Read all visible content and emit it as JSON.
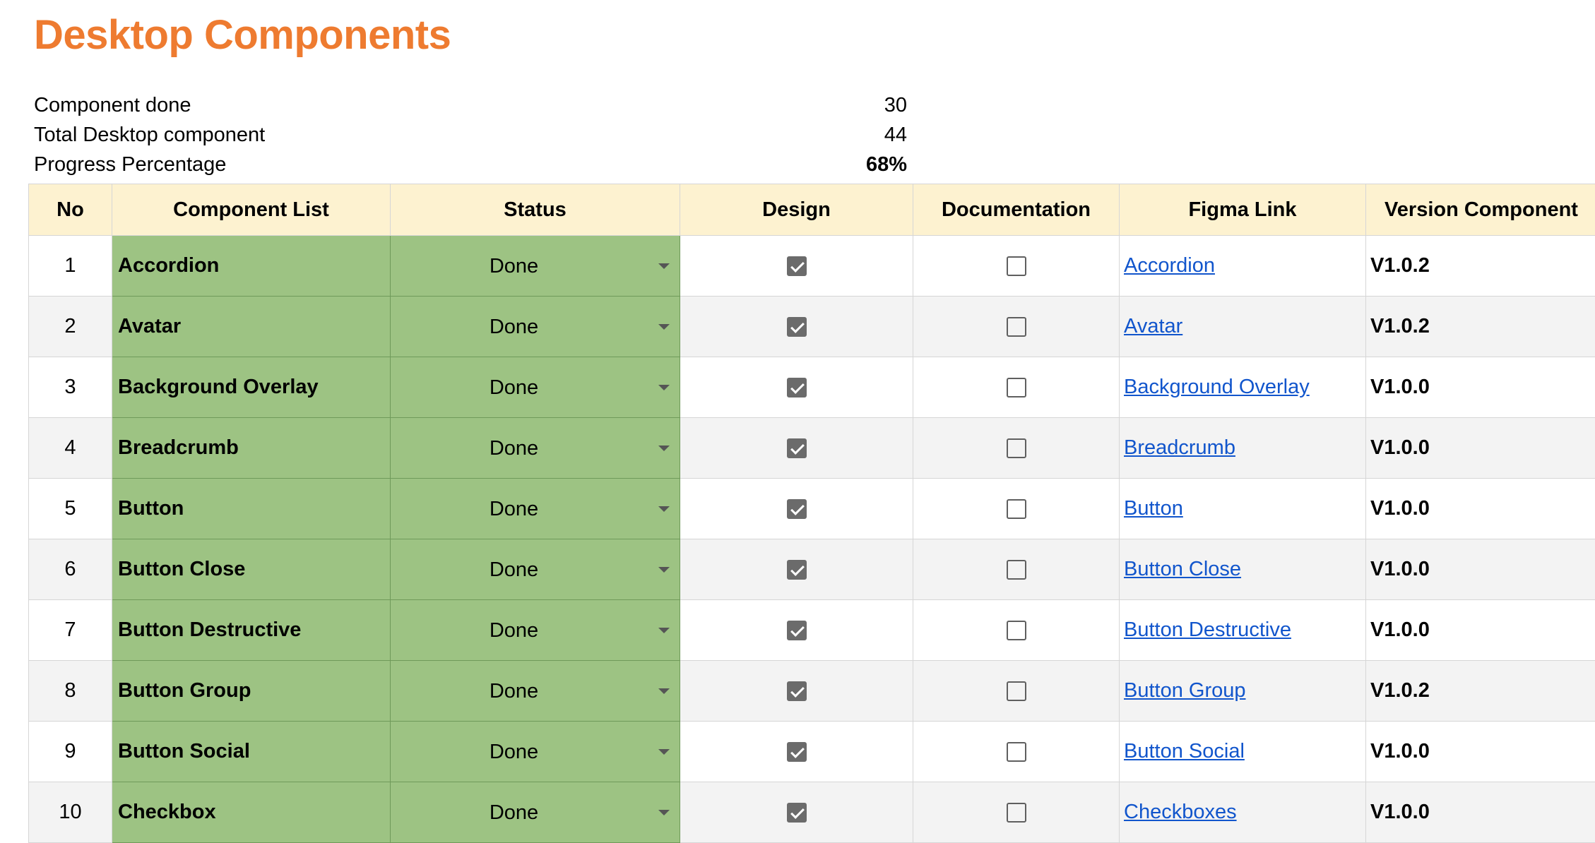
{
  "title": "Desktop Components",
  "summary": [
    {
      "label": "Component done",
      "value": "30"
    },
    {
      "label": "Total Desktop component",
      "value": "44"
    },
    {
      "label": "Progress Percentage",
      "value": "68%"
    }
  ],
  "colors": {
    "title": "#ee7b30",
    "header_bg": "#fdf2d0",
    "done_green": "#9dc383",
    "link": "#1155cc"
  },
  "table": {
    "headers": [
      "No",
      "Component List",
      "Status",
      "Design",
      "Documentation",
      "Figma Link",
      "Version Component"
    ],
    "rows": [
      {
        "no": "1",
        "name": "Accordion",
        "status": "Done",
        "design": true,
        "doc": false,
        "link": "Accordion",
        "version": "V1.0.2"
      },
      {
        "no": "2",
        "name": "Avatar",
        "status": "Done",
        "design": true,
        "doc": false,
        "link": "Avatar",
        "version": "V1.0.2"
      },
      {
        "no": "3",
        "name": "Background Overlay",
        "status": "Done",
        "design": true,
        "doc": false,
        "link": "Background Overlay",
        "version": "V1.0.0"
      },
      {
        "no": "4",
        "name": "Breadcrumb",
        "status": "Done",
        "design": true,
        "doc": false,
        "link": "Breadcrumb",
        "version": "V1.0.0"
      },
      {
        "no": "5",
        "name": "Button",
        "status": "Done",
        "design": true,
        "doc": false,
        "link": "Button",
        "version": "V1.0.0"
      },
      {
        "no": "6",
        "name": "Button Close",
        "status": "Done",
        "design": true,
        "doc": false,
        "link": "Button Close",
        "version": "V1.0.0"
      },
      {
        "no": "7",
        "name": "Button Destructive",
        "status": "Done",
        "design": true,
        "doc": false,
        "link": "Button Destructive",
        "version": "V1.0.0"
      },
      {
        "no": "8",
        "name": "Button Group",
        "status": "Done",
        "design": true,
        "doc": false,
        "link": "Button Group",
        "version": "V1.0.2"
      },
      {
        "no": "9",
        "name": "Button Social",
        "status": "Done",
        "design": true,
        "doc": false,
        "link": "Button Social",
        "version": "V1.0.0"
      },
      {
        "no": "10",
        "name": "Checkbox",
        "status": "Done",
        "design": true,
        "doc": false,
        "link": "Checkboxes",
        "version": "V1.0.0"
      }
    ]
  }
}
